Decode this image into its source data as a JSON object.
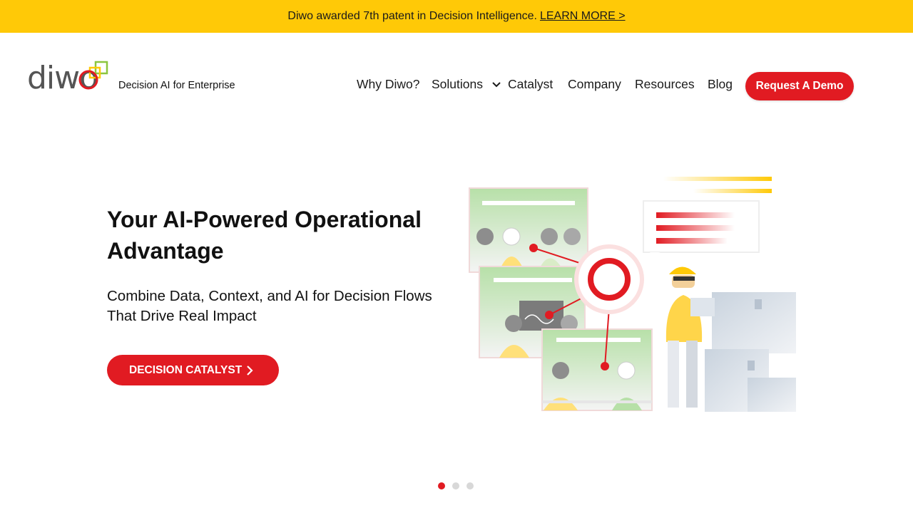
{
  "banner": {
    "text": "Diwo awarded 7th patent in Decision Intelligence.",
    "link_label": "LEARN MORE >"
  },
  "brand": {
    "logo_text": "diwo",
    "tagline": "Decision AI for Enterprise"
  },
  "nav": {
    "items": [
      {
        "label": "Why Diwo?"
      },
      {
        "label": "Solutions",
        "has_dropdown": true
      },
      {
        "label": "Catalyst"
      },
      {
        "label": "Company"
      },
      {
        "label": "Resources"
      },
      {
        "label": "Blog"
      }
    ],
    "cta_label": "Request A Demo"
  },
  "hero": {
    "title": "Your AI-Powered Operational Advantage",
    "subtitle": "Combine Data, Context, and AI for Decision Flows That Drive Real Impact",
    "cta_label": "DECISION CATALYST"
  },
  "carousel": {
    "total": 3,
    "active_index": 0
  },
  "colors": {
    "banner": "#ffc907",
    "accent_red": "#e11b22",
    "logo_green": "#8cc63f",
    "logo_yellow": "#ffc907"
  }
}
